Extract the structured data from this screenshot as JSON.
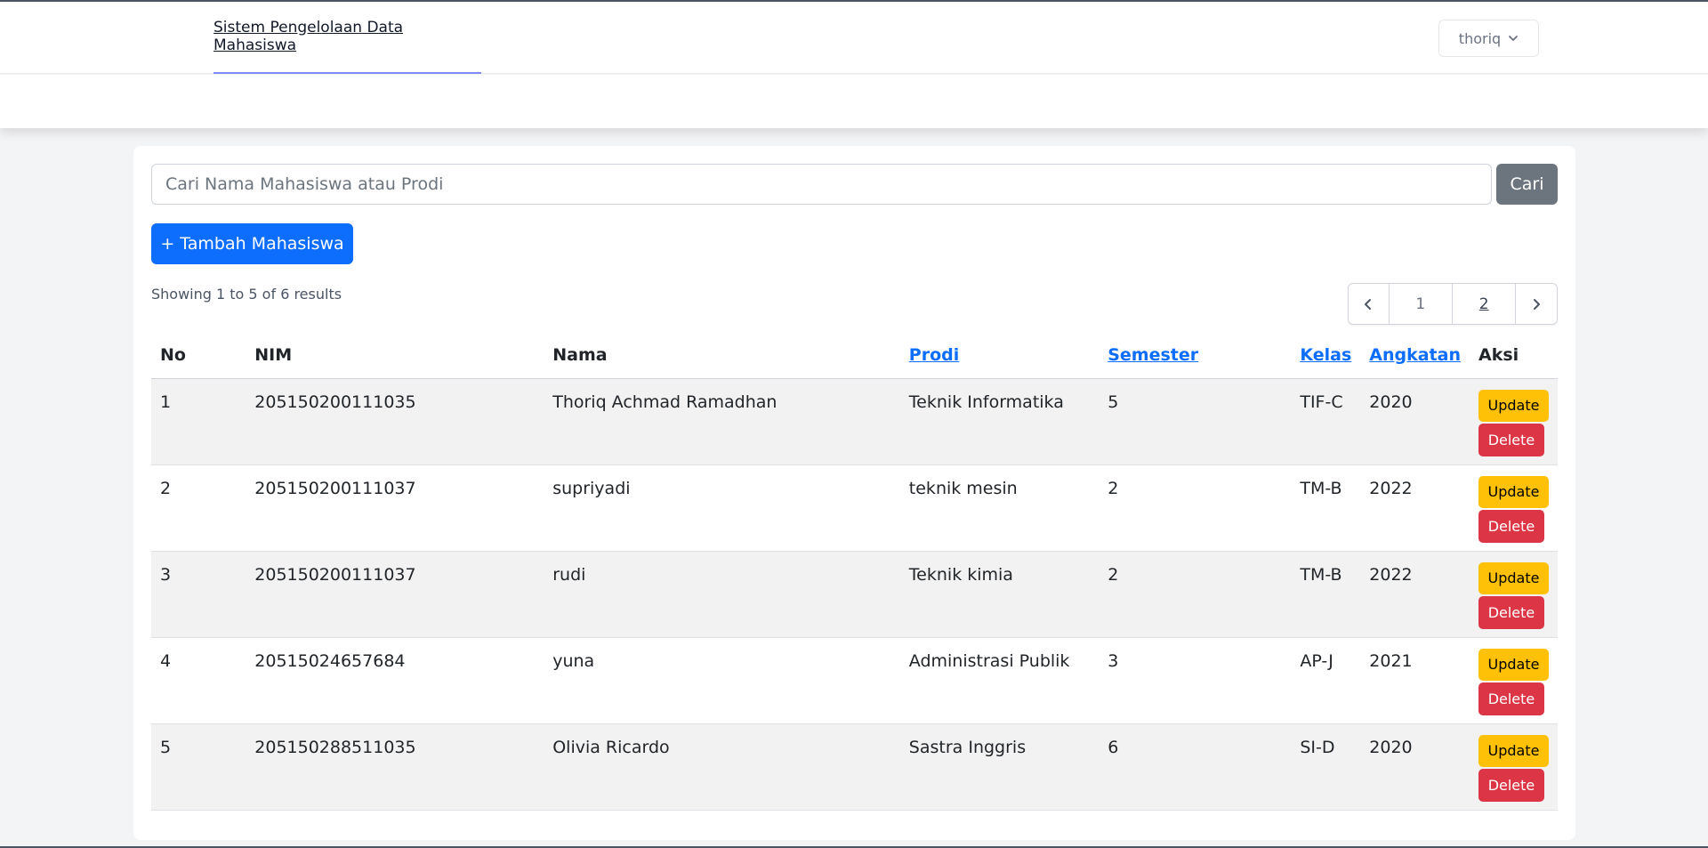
{
  "header": {
    "app_title": "Sistem Pengelolaan Data Mahasiswa",
    "user_name": "thoriq"
  },
  "search": {
    "placeholder": "Cari Nama Mahasiswa atau Prodi",
    "value": "",
    "button_label": "Cari"
  },
  "actions": {
    "add_label": "+ Tambah Mahasiswa"
  },
  "results_text": "Showing 1 to 5 of 6 results",
  "pagination": {
    "pages": [
      "1",
      "2"
    ],
    "current": "1"
  },
  "table": {
    "headers": [
      "No",
      "NIM",
      "Nama",
      "Prodi",
      "Semester",
      "Kelas",
      "Angkatan",
      "Aksi"
    ],
    "sortable": [
      "Prodi",
      "Semester",
      "Kelas",
      "Angkatan"
    ],
    "update_label": "Update",
    "delete_label": "Delete",
    "rows": [
      {
        "no": "1",
        "nim": "205150200111035",
        "nama": "Thoriq Achmad Ramadhan",
        "prodi": "Teknik Informatika",
        "semester": "5",
        "kelas": "TIF-C",
        "angkatan": "2020"
      },
      {
        "no": "2",
        "nim": "205150200111037",
        "nama": "supriyadi",
        "prodi": "teknik mesin",
        "semester": "2",
        "kelas": "TM-B",
        "angkatan": "2022"
      },
      {
        "no": "3",
        "nim": "205150200111037",
        "nama": "rudi",
        "prodi": "Teknik kimia",
        "semester": "2",
        "kelas": "TM-B",
        "angkatan": "2022"
      },
      {
        "no": "4",
        "nim": "20515024657684",
        "nama": "yuna",
        "prodi": "Administrasi Publik",
        "semester": "3",
        "kelas": "AP-J",
        "angkatan": "2021"
      },
      {
        "no": "5",
        "nim": "205150288511035",
        "nama": "Olivia Ricardo",
        "prodi": "Sastra Inggris",
        "semester": "6",
        "kelas": "SI-D",
        "angkatan": "2020"
      }
    ]
  },
  "colors": {
    "primary": "#0d6efd",
    "secondary": "#6c757d",
    "warning": "#ffc107",
    "danger": "#dc3545"
  }
}
